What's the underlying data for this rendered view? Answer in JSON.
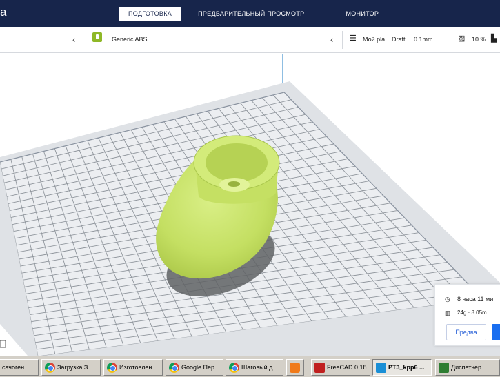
{
  "topbar": {
    "brand": "a",
    "tabs": [
      "ПОДГОТОВКА",
      "ПРЕДВАРИТЕЛЬНЫЙ ПРОСМОТР",
      "МОНИТОР"
    ],
    "active_tab": 0
  },
  "settings_strip": {
    "material": "Generic ABS",
    "profile_name": "Мой pla",
    "quality": "Draft",
    "layer_height": "0.1mm",
    "infill": "10 %",
    "colors": {
      "material_badge": "#8fb827",
      "header_bg": "#17254b"
    }
  },
  "print_panel": {
    "time": "8 часа 11 ми",
    "material_usage": "24g · 8.05m",
    "preview_button": "Предвa"
  },
  "taskbar": {
    "items": [
      {
        "label": "сачоген",
        "icon": "window-icon"
      },
      {
        "label": "Загрузка З...",
        "icon": "chrome-icon"
      },
      {
        "label": "Изготовлен...",
        "icon": "chrome-icon"
      },
      {
        "label": "Google Пер...",
        "icon": "chrome-icon"
      },
      {
        "label": "Шаговый д...",
        "icon": "chrome-icon"
      },
      {
        "label": "",
        "icon": "media-player-icon"
      },
      {
        "label": "FreeCAD 0.18",
        "icon": "freecad-icon"
      },
      {
        "label": "PT3_kpp6 ...",
        "icon": "cura-icon"
      },
      {
        "label": "Диспетчер ...",
        "icon": "task-manager-icon"
      }
    ]
  },
  "colors": {
    "model": "#c7e26a",
    "grid": "#8f959c",
    "plate": "#eceef1",
    "accent": "#196ef0"
  }
}
